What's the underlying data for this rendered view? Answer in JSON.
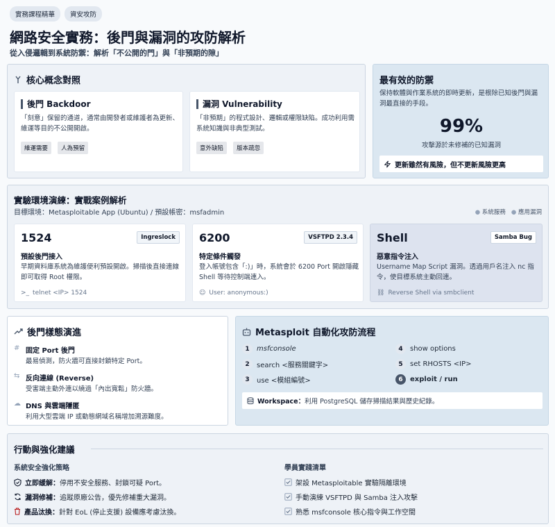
{
  "tags": [
    "實務課程精華",
    "資安攻防"
  ],
  "title": "網路安全實務：後門與漏洞的攻防解析",
  "subtitle": "從入侵邏輯到系統防禦：解析「不公開的門」與「非預期的隙」",
  "concepts": {
    "title": "核心概念對照",
    "backdoor": {
      "title": "後門 Backdoor",
      "desc": "「刻意」保留的通道，通常由開發者或維護者為更新、維運等目的不公開開啟。",
      "tags": [
        "維運需要",
        "人為預留"
      ]
    },
    "vuln": {
      "title": "漏洞 Vulnerability",
      "desc": "「非預期」的程式設計、邏輯或權限缺陷。成功利用需系統知識與非典型測試。",
      "tags": [
        "意外缺陷",
        "版本疏忽"
      ]
    }
  },
  "defense": {
    "title": "最有效的防禦",
    "desc": "保持軟體與作業系統的即時更新，是根除已知後門與漏洞最直接的手段。",
    "stat": "99%",
    "stat_label": "攻擊源於未修補的已知漏洞",
    "callout": "更新雖然有風險，但不更新風險更高"
  },
  "lab": {
    "title": "實驗環境演練：實戰案例解析",
    "env": "目標環境：Metasploitable App (Ubuntu) / 預設帳密：msfadmin",
    "legend": [
      "系統服務",
      "應用漏洞"
    ],
    "cards": [
      {
        "big": "1524",
        "badge": "Ingreslock",
        "head": "預設後門接入",
        "desc": "早期資料庫系統為維護便利預設開啟。掃描後直接連線即可取得 Root 權限。",
        "hint": "telnet <IP> 1524"
      },
      {
        "big": "6200",
        "badge": "VSFTPD 2.3.4",
        "head": "特定條件觸發",
        "desc": "登入帳號包含「:)」時，系統會於 6200 Port 開啟隱藏 Shell 等待控制端連入。",
        "hint": "User: anonymous:)"
      },
      {
        "big": "Shell",
        "badge": "Samba Bug",
        "head": "惡意指令注入",
        "desc": "Username Map Script 漏洞。透過用戶名注入 nc 指令，使目標系統主動回連。",
        "hint": "Reverse Shell via smbclient"
      }
    ]
  },
  "evolution": {
    "title": "後門樣態演進",
    "items": [
      {
        "head": "固定 Port 後門",
        "desc": "最易偵測，防火牆可直接封鎖特定 Port。"
      },
      {
        "head": "反向連線 (Reverse)",
        "desc": "受害端主動外連以繞過「內出寬鬆」防火牆。"
      },
      {
        "head": "DNS 與雲端隱匿",
        "desc": "利用大型雲端 IP 或動態網域名稱增加溯源難度。"
      }
    ]
  },
  "metasploit": {
    "title": "Metasploit 自動化攻防流程",
    "steps": [
      {
        "n": "1",
        "text": "msfconsole"
      },
      {
        "n": "2",
        "text": "search <服務關鍵字>"
      },
      {
        "n": "3",
        "text": "use <模組編號>"
      },
      {
        "n": "4",
        "text": "show options"
      },
      {
        "n": "5",
        "text": "set RHOSTS <IP>"
      },
      {
        "n": "6",
        "text": "exploit / run"
      }
    ],
    "workspace_label": "Workspace：",
    "workspace_text": "利用 PostgreSQL 儲存掃描結果與歷史紀錄。"
  },
  "actions": {
    "title": "行動與強化建議",
    "left_title": "系統安全強化策略",
    "left": [
      {
        "label": "立即緩解：",
        "text": "停用不安全服務、封鎖可疑 Port。"
      },
      {
        "label": "漏洞修補：",
        "text": "追蹤原廠公告，優先修補重大漏洞。"
      },
      {
        "label": "產品汰換：",
        "text": "針對 EoL (停止支援) 設備應考慮汰換。"
      }
    ],
    "right_title": "學員實踐清單",
    "right": [
      "架設 Metasploitable 實驗隔離環境",
      "手動演練 VSFTPD 與 Samba 注入攻擊",
      "熟悉 msfconsole 核心指令與工作空間"
    ]
  }
}
